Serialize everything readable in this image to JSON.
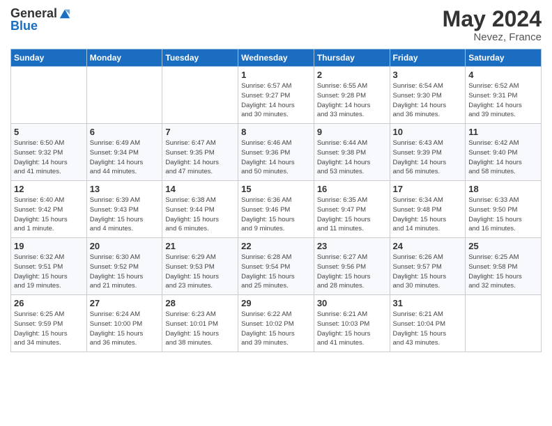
{
  "header": {
    "logo_general": "General",
    "logo_blue": "Blue",
    "month": "May 2024",
    "location": "Nevez, France"
  },
  "days_of_week": [
    "Sunday",
    "Monday",
    "Tuesday",
    "Wednesday",
    "Thursday",
    "Friday",
    "Saturday"
  ],
  "weeks": [
    [
      {
        "day": "",
        "info": ""
      },
      {
        "day": "",
        "info": ""
      },
      {
        "day": "",
        "info": ""
      },
      {
        "day": "1",
        "info": "Sunrise: 6:57 AM\nSunset: 9:27 PM\nDaylight: 14 hours\nand 30 minutes."
      },
      {
        "day": "2",
        "info": "Sunrise: 6:55 AM\nSunset: 9:28 PM\nDaylight: 14 hours\nand 33 minutes."
      },
      {
        "day": "3",
        "info": "Sunrise: 6:54 AM\nSunset: 9:30 PM\nDaylight: 14 hours\nand 36 minutes."
      },
      {
        "day": "4",
        "info": "Sunrise: 6:52 AM\nSunset: 9:31 PM\nDaylight: 14 hours\nand 39 minutes."
      }
    ],
    [
      {
        "day": "5",
        "info": "Sunrise: 6:50 AM\nSunset: 9:32 PM\nDaylight: 14 hours\nand 41 minutes."
      },
      {
        "day": "6",
        "info": "Sunrise: 6:49 AM\nSunset: 9:34 PM\nDaylight: 14 hours\nand 44 minutes."
      },
      {
        "day": "7",
        "info": "Sunrise: 6:47 AM\nSunset: 9:35 PM\nDaylight: 14 hours\nand 47 minutes."
      },
      {
        "day": "8",
        "info": "Sunrise: 6:46 AM\nSunset: 9:36 PM\nDaylight: 14 hours\nand 50 minutes."
      },
      {
        "day": "9",
        "info": "Sunrise: 6:44 AM\nSunset: 9:38 PM\nDaylight: 14 hours\nand 53 minutes."
      },
      {
        "day": "10",
        "info": "Sunrise: 6:43 AM\nSunset: 9:39 PM\nDaylight: 14 hours\nand 56 minutes."
      },
      {
        "day": "11",
        "info": "Sunrise: 6:42 AM\nSunset: 9:40 PM\nDaylight: 14 hours\nand 58 minutes."
      }
    ],
    [
      {
        "day": "12",
        "info": "Sunrise: 6:40 AM\nSunset: 9:42 PM\nDaylight: 15 hours\nand 1 minute."
      },
      {
        "day": "13",
        "info": "Sunrise: 6:39 AM\nSunset: 9:43 PM\nDaylight: 15 hours\nand 4 minutes."
      },
      {
        "day": "14",
        "info": "Sunrise: 6:38 AM\nSunset: 9:44 PM\nDaylight: 15 hours\nand 6 minutes."
      },
      {
        "day": "15",
        "info": "Sunrise: 6:36 AM\nSunset: 9:46 PM\nDaylight: 15 hours\nand 9 minutes."
      },
      {
        "day": "16",
        "info": "Sunrise: 6:35 AM\nSunset: 9:47 PM\nDaylight: 15 hours\nand 11 minutes."
      },
      {
        "day": "17",
        "info": "Sunrise: 6:34 AM\nSunset: 9:48 PM\nDaylight: 15 hours\nand 14 minutes."
      },
      {
        "day": "18",
        "info": "Sunrise: 6:33 AM\nSunset: 9:50 PM\nDaylight: 15 hours\nand 16 minutes."
      }
    ],
    [
      {
        "day": "19",
        "info": "Sunrise: 6:32 AM\nSunset: 9:51 PM\nDaylight: 15 hours\nand 19 minutes."
      },
      {
        "day": "20",
        "info": "Sunrise: 6:30 AM\nSunset: 9:52 PM\nDaylight: 15 hours\nand 21 minutes."
      },
      {
        "day": "21",
        "info": "Sunrise: 6:29 AM\nSunset: 9:53 PM\nDaylight: 15 hours\nand 23 minutes."
      },
      {
        "day": "22",
        "info": "Sunrise: 6:28 AM\nSunset: 9:54 PM\nDaylight: 15 hours\nand 25 minutes."
      },
      {
        "day": "23",
        "info": "Sunrise: 6:27 AM\nSunset: 9:56 PM\nDaylight: 15 hours\nand 28 minutes."
      },
      {
        "day": "24",
        "info": "Sunrise: 6:26 AM\nSunset: 9:57 PM\nDaylight: 15 hours\nand 30 minutes."
      },
      {
        "day": "25",
        "info": "Sunrise: 6:25 AM\nSunset: 9:58 PM\nDaylight: 15 hours\nand 32 minutes."
      }
    ],
    [
      {
        "day": "26",
        "info": "Sunrise: 6:25 AM\nSunset: 9:59 PM\nDaylight: 15 hours\nand 34 minutes."
      },
      {
        "day": "27",
        "info": "Sunrise: 6:24 AM\nSunset: 10:00 PM\nDaylight: 15 hours\nand 36 minutes."
      },
      {
        "day": "28",
        "info": "Sunrise: 6:23 AM\nSunset: 10:01 PM\nDaylight: 15 hours\nand 38 minutes."
      },
      {
        "day": "29",
        "info": "Sunrise: 6:22 AM\nSunset: 10:02 PM\nDaylight: 15 hours\nand 39 minutes."
      },
      {
        "day": "30",
        "info": "Sunrise: 6:21 AM\nSunset: 10:03 PM\nDaylight: 15 hours\nand 41 minutes."
      },
      {
        "day": "31",
        "info": "Sunrise: 6:21 AM\nSunset: 10:04 PM\nDaylight: 15 hours\nand 43 minutes."
      },
      {
        "day": "",
        "info": ""
      }
    ]
  ]
}
